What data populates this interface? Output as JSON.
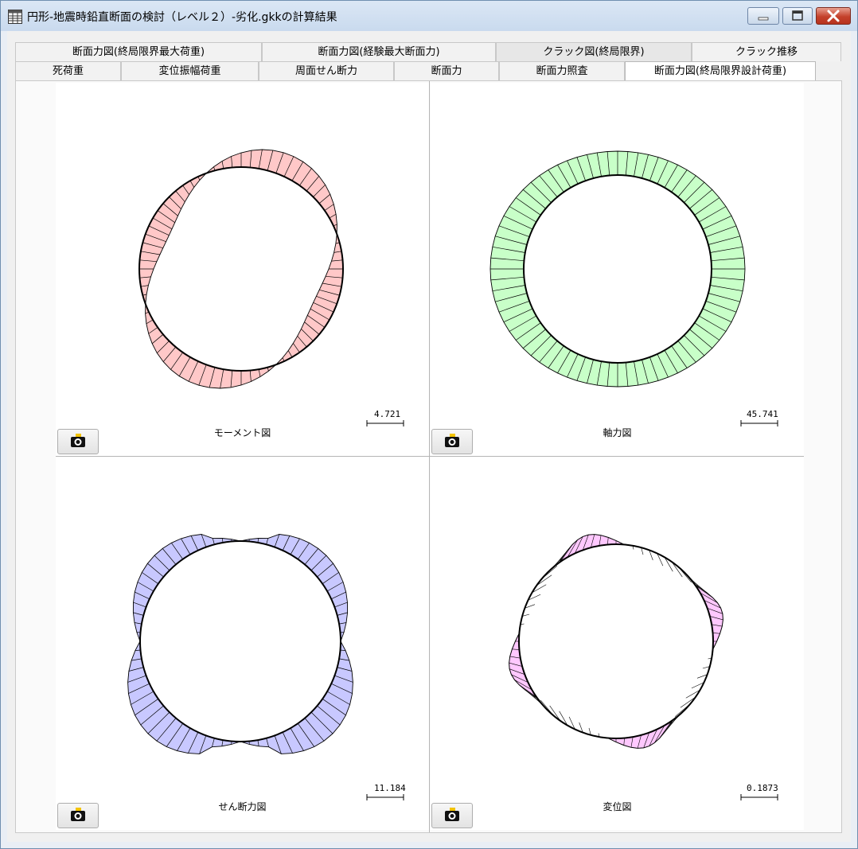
{
  "window": {
    "title": "円形-地震時鉛直断面の検討（レベル２）-劣化.gkkの計算結果"
  },
  "tabs_row1": [
    "断面力図(終局限界最大荷重)",
    "断面力図(経験最大断面力)",
    "クラック図(終局限界)",
    "クラック推移"
  ],
  "tabs_row2": [
    "死荷重",
    "変位振幅荷重",
    "周面せん断力",
    "断面力",
    "断面力照査",
    "断面力図(終局限界設計荷重)"
  ],
  "diagrams": {
    "moment": {
      "label": "モーメント図",
      "scale": "4.721",
      "fill": "#ffc8c8"
    },
    "axial": {
      "label": "軸力図",
      "scale": "45.741",
      "fill": "#c8ffc8"
    },
    "shear": {
      "label": "せん断力図",
      "scale": "11.184",
      "fill": "#c8c8ff"
    },
    "displacement": {
      "label": "変位図",
      "scale": "0.1873",
      "fill": "#ffc8ff"
    }
  },
  "icons": {
    "camera": "camera-icon"
  }
}
